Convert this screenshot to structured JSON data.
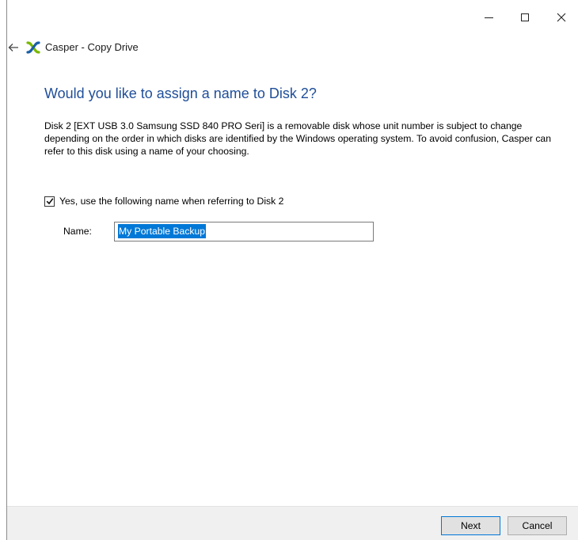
{
  "window": {
    "app_name": "Casper",
    "separator": " - ",
    "page_name": "Copy Drive"
  },
  "icons": {
    "back": "back-arrow-icon",
    "logo": "casper-logo-icon",
    "minimize": "minimize-icon",
    "maximize": "maximize-icon",
    "close": "close-icon",
    "checkmark": "checkmark-icon"
  },
  "main": {
    "heading": "Would you like to assign a name to Disk 2?",
    "description": "Disk 2 [EXT USB 3.0 Samsung SSD 840 PRO Seri] is a removable disk whose unit number is subject to change depending on the order in which disks are identified by the Windows operating system. To avoid confusion, Casper can refer to this disk using a name of your choosing.",
    "use_name_checkbox": {
      "checked": true,
      "label": "Yes, use the following name when referring to Disk 2"
    },
    "name_field": {
      "label": "Name:",
      "value": "My Portable Backup"
    }
  },
  "footer": {
    "next_label": "Next",
    "cancel_label": "Cancel"
  },
  "colors": {
    "heading": "#1f4e99",
    "selection": "#0078d7",
    "logo_green": "#7ab800",
    "logo_blue": "#1a5fa8"
  }
}
